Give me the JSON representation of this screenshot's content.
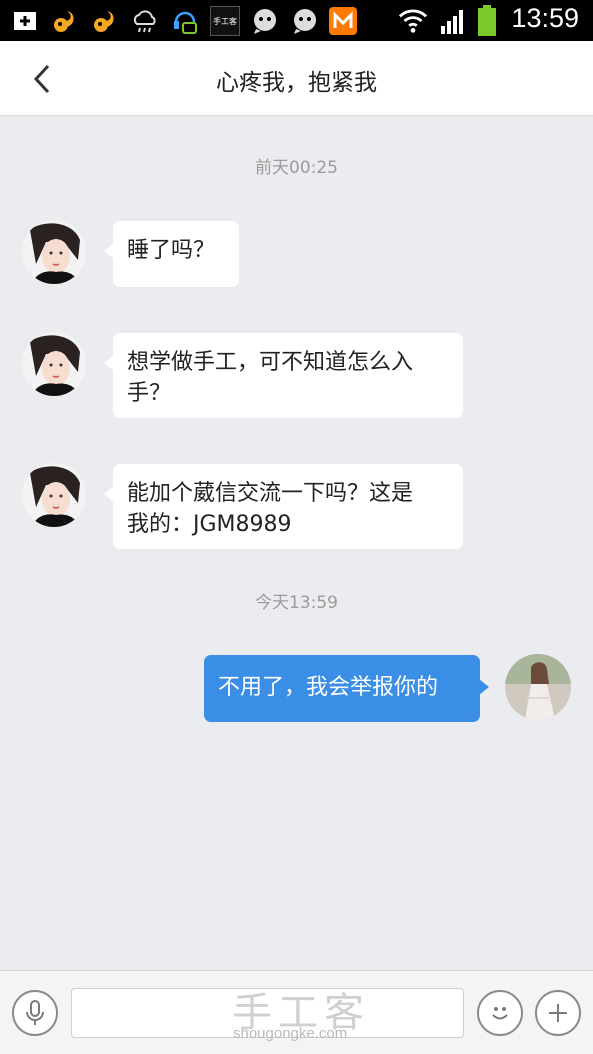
{
  "status_bar": {
    "icons": [
      "add-box-icon",
      "squirrel-icon",
      "squirrel-icon",
      "cloud-rain-icon",
      "headset-chat-icon",
      "shougongke-app-icon",
      "chat-bubble-icon",
      "chat-bubble-icon",
      "mango-tv-icon",
      "wifi-icon",
      "signal-icon",
      "battery-icon"
    ],
    "app_icon_text": "手工客",
    "time": "13:59"
  },
  "header": {
    "title": "心疼我，抱紧我",
    "back_icon": "back-chevron-icon"
  },
  "chat": {
    "timestamps": [
      "前天00:25",
      "今天13:59"
    ],
    "messages": [
      {
        "direction": "incoming",
        "line1": "睡了吗？",
        "line2": ""
      },
      {
        "direction": "incoming",
        "line1": "想学做手工，可不知道怎么入",
        "line2": "手？"
      },
      {
        "direction": "incoming",
        "line1": "能加个葳信交流一下吗？这是",
        "line2": "我的：JGM8989"
      },
      {
        "direction": "outgoing",
        "line1": "不用了，我会举报你的",
        "line2": ""
      }
    ]
  },
  "input_bar": {
    "voice_icon": "microphone-icon",
    "emoji_icon": "smiley-icon",
    "plus_icon": "plus-icon",
    "text_value": ""
  },
  "watermark": {
    "main": "手工客",
    "sub": "shougongke.com"
  },
  "colors": {
    "accent_blue": "#3a8ee6",
    "chat_background": "#ebecef",
    "battery_green": "#7cc72a"
  }
}
